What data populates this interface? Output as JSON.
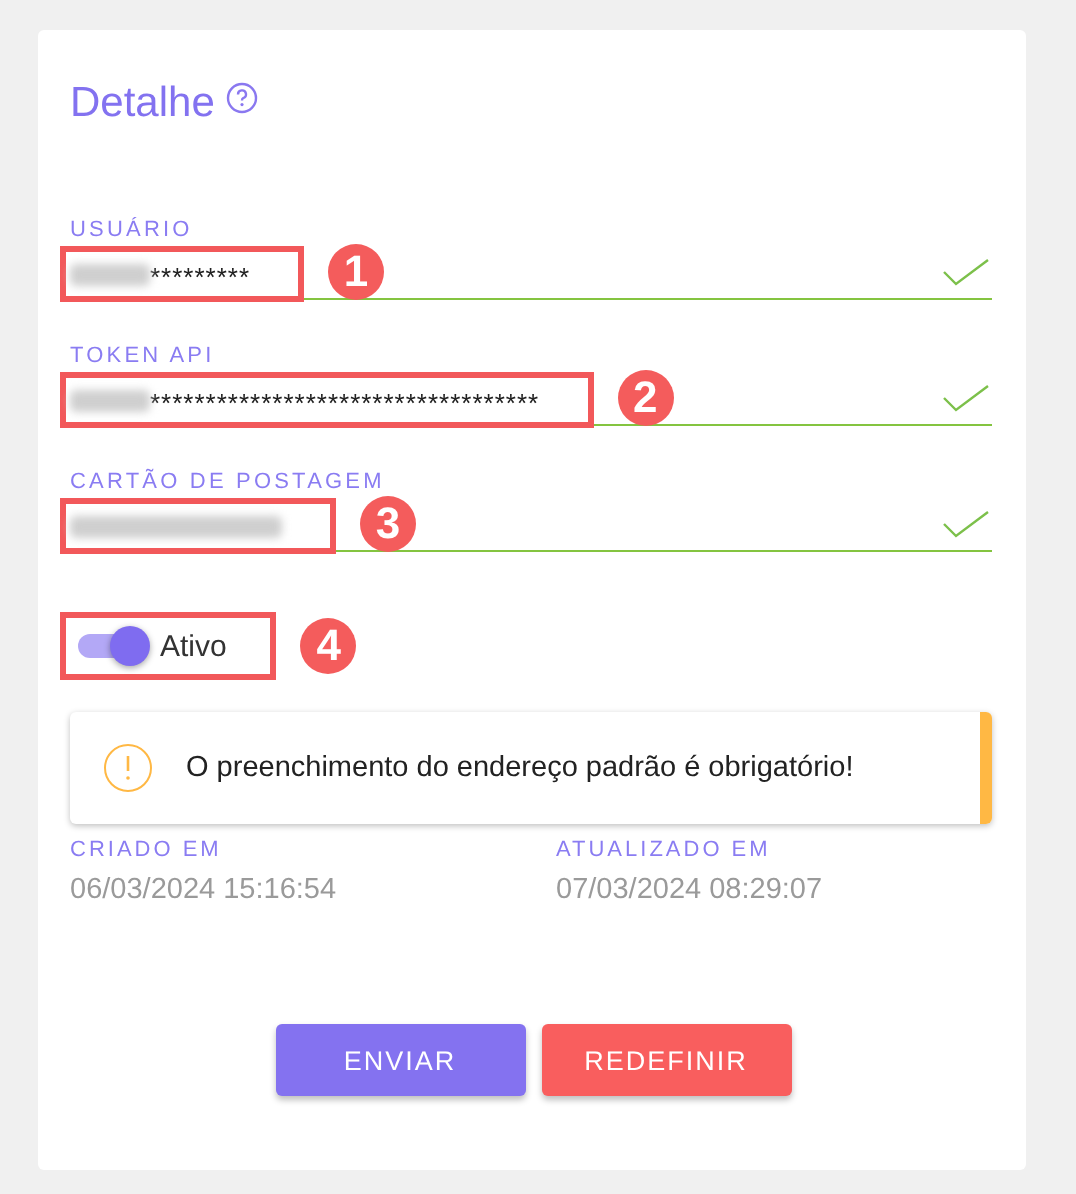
{
  "title": "Detalhe",
  "fields": [
    {
      "label": "USUÁRIO",
      "kind": "masked",
      "value": "*********",
      "valid": true,
      "callout": "1"
    },
    {
      "label": "TOKEN API",
      "kind": "masked",
      "value": "***********************************",
      "valid": true,
      "callout": "2"
    },
    {
      "label": "CARTÃO DE POSTAGEM",
      "kind": "blurred",
      "valid": true,
      "callout": "3"
    }
  ],
  "toggle": {
    "label": "Ativo",
    "on": true,
    "callout": "4"
  },
  "alert": {
    "kind": "warning",
    "message": "O preenchimento do endereço padrão é obrigatório!"
  },
  "meta": [
    {
      "label": "CRIADO EM",
      "value": "06/03/2024 15:16:54"
    },
    {
      "label": "ATUALIZADO EM",
      "value": "07/03/2024 08:29:07"
    }
  ],
  "buttons": [
    {
      "label": "ENVIAR",
      "kind": "primary"
    },
    {
      "label": "REDEFINIR",
      "kind": "reset"
    }
  ]
}
